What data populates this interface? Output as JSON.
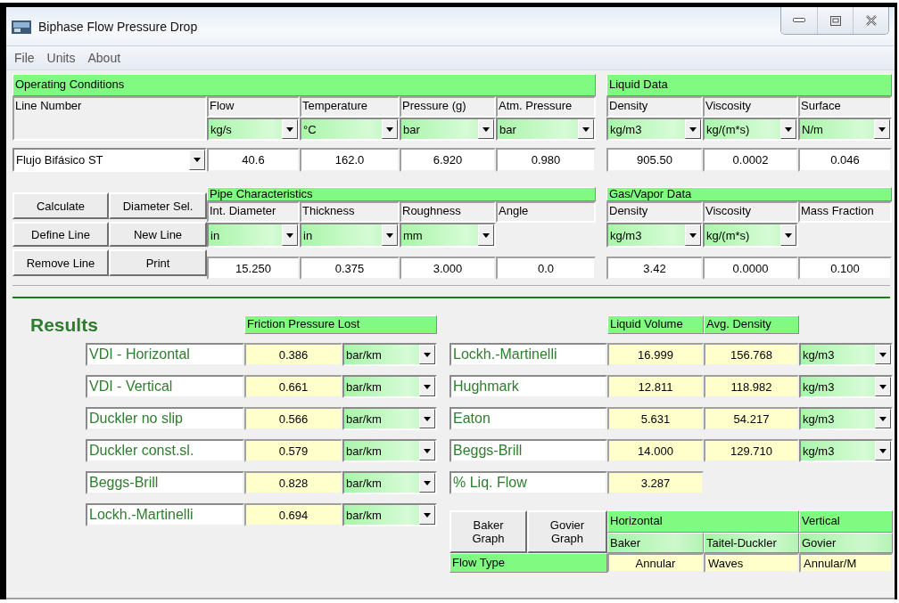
{
  "window": {
    "title": "Biphase Flow Pressure Drop"
  },
  "menu": [
    "File",
    "Units",
    "About"
  ],
  "operating_conditions": {
    "title": "Operating Conditions",
    "line_label": "Line Number",
    "line_value": "Flujo Bifásico ST",
    "columns": [
      {
        "label": "Flow",
        "unit": "kg/s",
        "value": "40.6"
      },
      {
        "label": "Temperature",
        "unit": "°C",
        "value": "162.0"
      },
      {
        "label": "Pressure (g)",
        "unit": "bar",
        "value": "6.920"
      },
      {
        "label": "Atm. Pressure",
        "unit": "bar",
        "value": "0.980"
      }
    ]
  },
  "liquid_data": {
    "title": "Liquid Data",
    "columns": [
      {
        "label": "Density",
        "unit": "kg/m3",
        "value": "905.50"
      },
      {
        "label": "Viscosity",
        "unit": "kg/(m*s)",
        "value": "0.0002"
      },
      {
        "label": "Surface",
        "unit": "N/m",
        "value": "0.046"
      }
    ]
  },
  "buttons": [
    "Calculate",
    "Diameter Sel.",
    "Define Line",
    "New Line",
    "Remove Line",
    "Print"
  ],
  "pipe_characteristics": {
    "title": "Pipe Characteristics",
    "columns": [
      {
        "label": "Int. Diameter",
        "unit": "in",
        "value": "15.250"
      },
      {
        "label": "Thickness",
        "unit": "in",
        "value": "0.375"
      },
      {
        "label": "Roughness",
        "unit": "mm",
        "value": "3.000"
      },
      {
        "label": "Angle",
        "value": "0.0"
      }
    ]
  },
  "gas_vapor_data": {
    "title": "Gas/Vapor Data",
    "columns": [
      {
        "label": "Density",
        "unit": "kg/m3",
        "value": "3.42"
      },
      {
        "label": "Viscosity",
        "unit": "kg/(m*s)",
        "value": "0.0000"
      },
      {
        "label": "Mass Fraction",
        "value": "0.100"
      }
    ]
  },
  "results": {
    "title": "Results",
    "friction": {
      "header": "Friction Pressure Lost",
      "rows": [
        {
          "label": "VDI - Horizontal",
          "value": "0.386",
          "unit": "bar/km"
        },
        {
          "label": "VDI - Vertical",
          "value": "0.661",
          "unit": "bar/km"
        },
        {
          "label": "Duckler no slip",
          "value": "0.566",
          "unit": "bar/km"
        },
        {
          "label": "Duckler const.sl.",
          "value": "0.579",
          "unit": "bar/km"
        },
        {
          "label": "Beggs-Brill",
          "value": "0.828",
          "unit": "bar/km"
        },
        {
          "label": "Lockh.-Martinelli",
          "value": "0.694",
          "unit": "bar/km"
        }
      ]
    },
    "holdup": {
      "headers": [
        "Liquid Volume",
        "Avg. Density"
      ],
      "rows": [
        {
          "label": "Lockh.-Martinelli",
          "liquid_volume": "16.999",
          "avg_density": "156.768",
          "unit": "kg/m3"
        },
        {
          "label": "Hughmark",
          "liquid_volume": "12.811",
          "avg_density": "118.982",
          "unit": "kg/m3"
        },
        {
          "label": "Eaton",
          "liquid_volume": "5.631",
          "avg_density": "54.217",
          "unit": "kg/m3"
        },
        {
          "label": "Beggs-Brill",
          "liquid_volume": "14.000",
          "avg_density": "129.710",
          "unit": "kg/m3"
        }
      ],
      "liquid_flow": {
        "label": "% Liq. Flow",
        "value": "3.287"
      }
    },
    "flow_type": {
      "buttons": [
        "Baker Graph",
        "Govier Graph"
      ],
      "groups": [
        "Horizontal",
        "Vertical"
      ],
      "label": "Flow Type",
      "methods": [
        {
          "name": "Baker",
          "result": "Annular"
        },
        {
          "name": "Taitel-Duckler",
          "result": "Waves"
        },
        {
          "name": "Govier",
          "result": "Annular/M"
        }
      ]
    }
  }
}
